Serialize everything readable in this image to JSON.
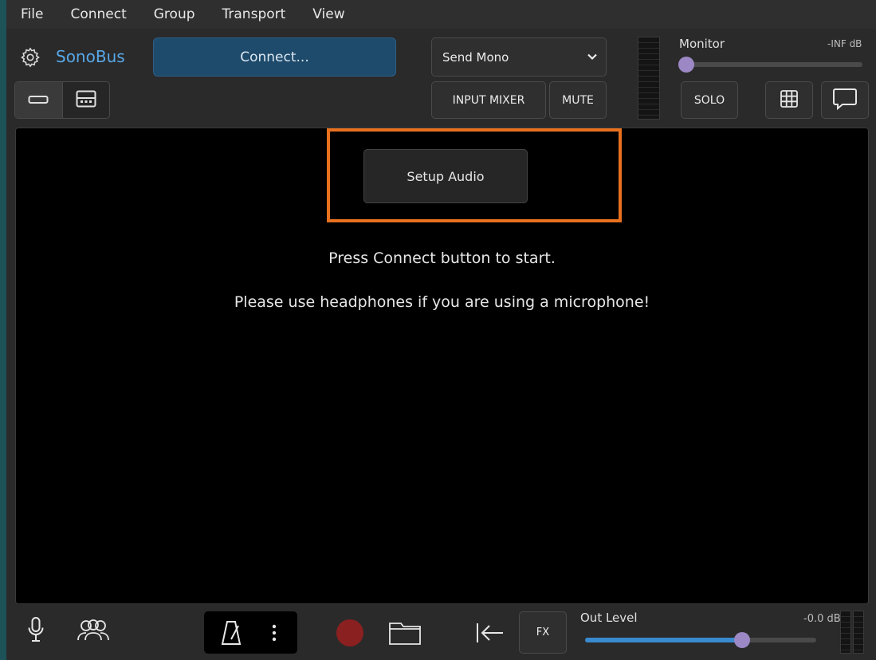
{
  "menu": [
    "File",
    "Connect",
    "Group",
    "Transport",
    "View"
  ],
  "header": {
    "app_name": "SonoBus",
    "connect_label": "Connect...",
    "send_mode": "Send Mono",
    "input_mixer_label": "INPUT MIXER",
    "mute_label": "MUTE",
    "monitor_label": "Monitor",
    "monitor_db": "-INF dB",
    "monitor_level": 0.0,
    "solo_label": "SOLO"
  },
  "main": {
    "setup_audio_label": "Setup Audio",
    "message_1": "Press Connect button to start.",
    "message_2": "Please use headphones if you are using a microphone!"
  },
  "footer": {
    "fx_label": "FX",
    "out_level_label": "Out Level",
    "out_level_db": "-0.0 dB",
    "out_level": 0.68
  },
  "colors": {
    "accent": "#58a8e8",
    "connect_bg": "#1e4a6b",
    "highlight": "#e8711f",
    "slider_thumb": "#9b88c4",
    "slider_fill": "#3a8ad0",
    "record": "#8b2020"
  },
  "icons": {
    "settings": "gear-icon",
    "view_single": "single-row-icon",
    "view_multi": "multi-row-icon",
    "grid": "grid-icon",
    "chat": "chat-bubble-icon",
    "mic": "microphone-icon",
    "people": "people-icon",
    "metronome": "metronome-icon",
    "more": "more-vertical-icon",
    "record": "record-icon",
    "folder": "folder-icon",
    "skip_back": "skip-back-icon"
  }
}
